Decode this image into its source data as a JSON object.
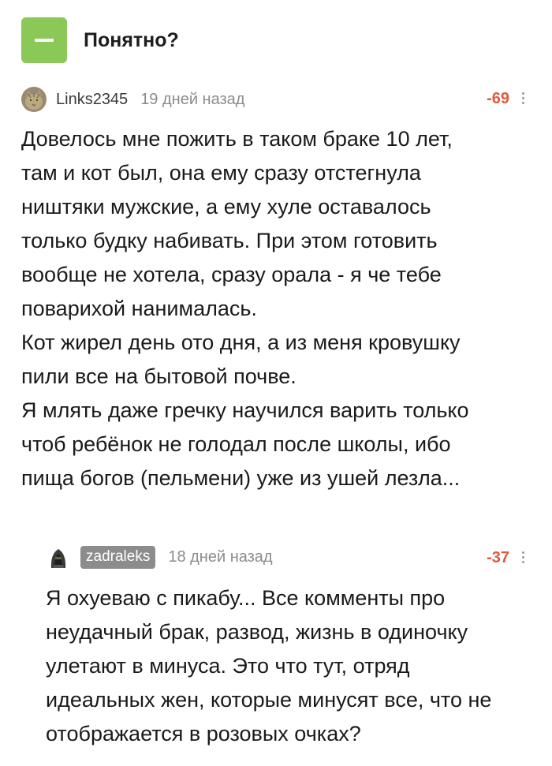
{
  "post": {
    "title": "Понятно?"
  },
  "comments": [
    {
      "author": "Links2345",
      "time": "19 дней назад",
      "rating": "-69",
      "lines": [
        "Довелось мне пожить в таком браке 10 лет,",
        "там и кот был, она ему сразу отстегнула",
        "ништяки мужские, а ему хуле оставалось",
        "только будку набивать. При этом готовить",
        "вообще не хотела, сразу орала - я че тебе",
        "поварихой нанималась.",
        "Кот жирел день ото дня, а из меня кровушку",
        "пили все на бытовой почве.",
        "Я млять даже гречку научился варить только",
        "чтоб ребёнок не голодал после школы, ибо",
        "пища богов (пельмени) уже из ушей лезла..."
      ]
    },
    {
      "author": "zadraleks",
      "time": "18 дней назад",
      "rating": "-37",
      "lines": [
        "Я охуеваю с пикабу... Все комменты про",
        "неудачный брак, развод, жизнь в одиночку",
        "улетают в минуса. Это что тут, отряд",
        "идеальных жен, которые минусят все, что не",
        "отображается в розовых очках?"
      ]
    }
  ],
  "colors": {
    "accent": "#8ac858",
    "rating": "#e05a3a",
    "muted": "#8c8c8c"
  },
  "icons": {
    "collapse": "minus-icon",
    "more": "more-vertical-icon"
  }
}
